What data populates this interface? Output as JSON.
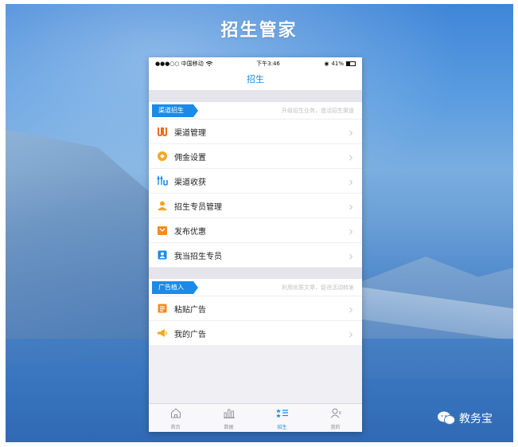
{
  "poster": {
    "title": "招生管家",
    "watermark": "教务宝"
  },
  "status_bar": {
    "carrier": "●●●○○ 中国移动",
    "time": "下午3:46",
    "battery": "41%",
    "battery_level": 0.41
  },
  "nav": {
    "title": "招生"
  },
  "sections": [
    {
      "tag": "渠道招生",
      "hint": "升级招生业务，盘活招生渠道",
      "items": [
        {
          "label": "渠道管理",
          "icon": "channel-manage-icon",
          "color": "#f26b1d"
        },
        {
          "label": "佣金设置",
          "icon": "commission-icon",
          "color": "#f5a623"
        },
        {
          "label": "渠道收获",
          "icon": "channel-harvest-icon",
          "color": "#1a8be8"
        },
        {
          "label": "招生专员管理",
          "icon": "recruiter-icon",
          "color": "#f5a623"
        },
        {
          "label": "发布优惠",
          "icon": "coupon-icon",
          "color": "#f58a1f"
        },
        {
          "label": "我当招生专员",
          "icon": "badge-icon",
          "color": "#1a8be8"
        }
      ]
    },
    {
      "tag": "广告植入",
      "hint": "利用优质文章，促进活动转发",
      "items": [
        {
          "label": "粘贴广告",
          "icon": "paste-ad-icon",
          "color": "#f58a1f"
        },
        {
          "label": "我的广告",
          "icon": "megaphone-icon",
          "color": "#f5a623"
        }
      ]
    }
  ],
  "tabbar": [
    {
      "label": "首页",
      "icon": "home-icon",
      "active": false
    },
    {
      "label": "数据",
      "icon": "chart-icon",
      "active": false
    },
    {
      "label": "招生",
      "icon": "list-star-icon",
      "active": true
    },
    {
      "label": "我的",
      "icon": "user-icon",
      "active": false
    }
  ],
  "colors": {
    "accent": "#1a8be8",
    "orange": "#f58a1f"
  }
}
